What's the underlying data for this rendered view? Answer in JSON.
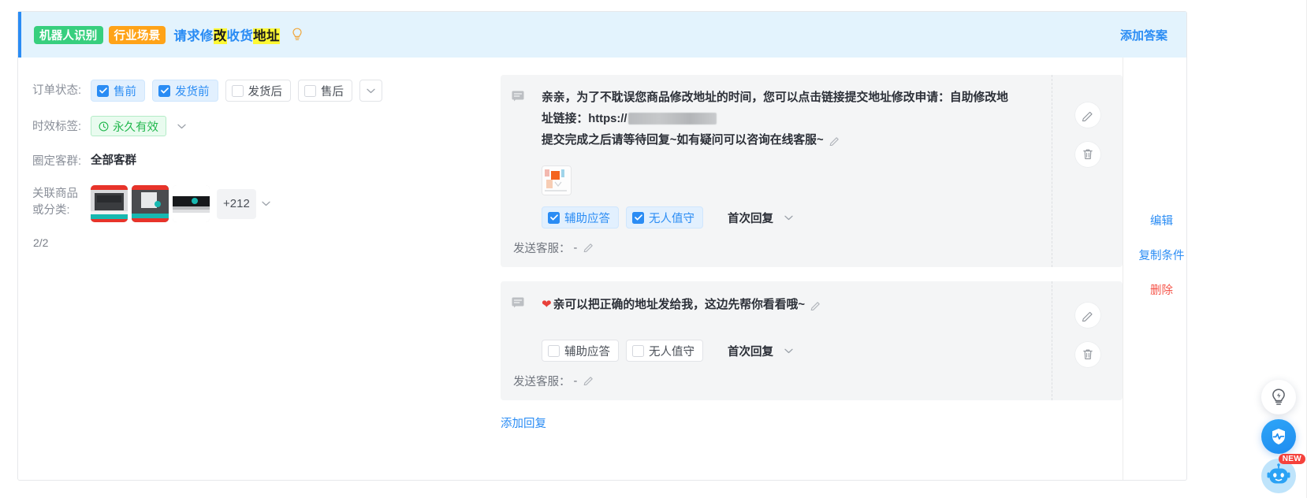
{
  "header": {
    "tag_robot": "机器人识别",
    "tag_industry": "行业场景",
    "title_parts": [
      {
        "text": "请求修",
        "highlight": false
      },
      {
        "text": "改",
        "highlight": true
      },
      {
        "text": "收货",
        "highlight": false
      },
      {
        "text": "地址",
        "highlight": true
      }
    ],
    "title_plain": "请求修改收货地址",
    "bulb_icon": "lightbulb-icon",
    "add_answer_label": "添加答案",
    "accent_color": "#2a8cf4",
    "background_color": "#e3f3fd",
    "tag_robot_color": "#37cf7e",
    "tag_industry_color": "#ffa318",
    "highlight_color": "#fdf834"
  },
  "conditions": {
    "order_status": {
      "label": "订单状态:",
      "options": [
        {
          "label": "售前",
          "checked": true
        },
        {
          "label": "发货前",
          "checked": true
        },
        {
          "label": "发货后",
          "checked": false
        },
        {
          "label": "售后",
          "checked": false
        }
      ],
      "expand_icon": "chevron-down-icon"
    },
    "validity": {
      "label": "时效标签:",
      "value": "永久有效",
      "clock_icon": "clock-icon",
      "tag_color": "#23b84f",
      "expand_icon": "chevron-down-icon"
    },
    "customer_group": {
      "label": "圈定客群:",
      "value": "全部客群"
    },
    "related_products": {
      "label": "关联商品\n或分类:",
      "label_line1": "关联商品",
      "label_line2": "或分类:",
      "thumbnails": [
        "product-thumbnail-1",
        "product-thumbnail-2",
        "product-thumbnail-3"
      ],
      "more_count": "+212",
      "expand_icon": "chevron-down-icon"
    },
    "pagination_count": "2/2"
  },
  "answers": [
    {
      "message_icon": "message-bubble-icon",
      "text_line1": "亲亲，为了不耽误您商品修改地址的时间，您可以点击链接提交地址修改申请：自助修改地",
      "text_line2_prefix": "址链接：https://",
      "text_line2_redacted": true,
      "text_line3": "提交完成之后请等待回复~如有疑问可以咨询在线客服~",
      "edit_pencil_icon": "pencil-icon",
      "attachment": "image-attachment-thumbnail",
      "toggles": [
        {
          "label": "辅助应答",
          "checked": true
        },
        {
          "label": "无人值守",
          "checked": true
        }
      ],
      "reply_timing": "首次回复",
      "reply_timing_icon": "chevron-down-icon",
      "sender_label": "发送客服：",
      "sender_value": "-",
      "sender_edit_icon": "pencil-icon",
      "card_edit_icon": "pencil-circle-icon",
      "card_delete_icon": "trash-circle-icon"
    },
    {
      "message_icon": "message-bubble-icon",
      "heart": "❤",
      "text_line1": "亲可以把正确的地址发给我，这边先帮你看看哦~",
      "edit_pencil_icon": "pencil-icon",
      "toggles": [
        {
          "label": "辅助应答",
          "checked": false
        },
        {
          "label": "无人值守",
          "checked": false
        }
      ],
      "reply_timing": "首次回复",
      "reply_timing_icon": "chevron-down-icon",
      "sender_label": "发送客服：",
      "sender_value": "-",
      "sender_edit_icon": "pencil-icon",
      "card_edit_icon": "pencil-circle-icon",
      "card_delete_icon": "trash-circle-icon"
    }
  ],
  "add_reply_label": "添加回复",
  "operations": {
    "edit": "编辑",
    "copy_condition": "复制条件",
    "delete": "删除",
    "edit_color": "#2a8cf4",
    "delete_color": "#f5554a"
  },
  "floating": {
    "bulb": "lightbulb-float-icon",
    "shield": "shield-pulse-icon",
    "bot": "robot-assistant-icon",
    "new_badge": "NEW"
  }
}
